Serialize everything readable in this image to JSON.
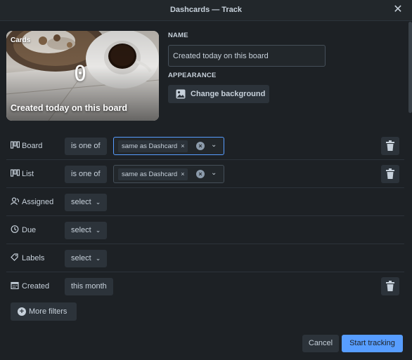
{
  "window": {
    "title": "Dashcards — Track",
    "close_glyph": "✕",
    "close_icon": "close-icon"
  },
  "preview": {
    "cards_label": "Cards",
    "count": "0",
    "name": "Created today on this board"
  },
  "name_section": {
    "label": "NAME",
    "value": "Created today on this board"
  },
  "appearance": {
    "label": "APPEARANCE",
    "button_label": "Change background",
    "icon": "image-icon"
  },
  "filters": [
    {
      "key": "board",
      "label": "Board",
      "icon": "board-icon",
      "operator": "is one of",
      "tag": "same as Dashcard",
      "focused": true,
      "deletable": true
    },
    {
      "key": "list",
      "label": "List",
      "icon": "list-icon",
      "operator": "is one of",
      "tag": "same as Dashcard",
      "focused": false,
      "deletable": true
    },
    {
      "key": "assigned",
      "label": "Assigned",
      "icon": "people-icon",
      "select": "select",
      "deletable": false
    },
    {
      "key": "due",
      "label": "Due",
      "icon": "clock-icon",
      "select": "select",
      "deletable": false
    },
    {
      "key": "labels",
      "label": "Labels",
      "icon": "tag-icon",
      "select": "select",
      "deletable": false
    },
    {
      "key": "created",
      "label": "Created",
      "icon": "calendar-icon",
      "select": "this month",
      "deletable": true
    }
  ],
  "tag_remove_glyph": "×",
  "chevron_glyph": "⌄",
  "clear_glyph": "×",
  "more_filters": {
    "label": "More filters",
    "plus_glyph": "+"
  },
  "footer": {
    "cancel_label": "Cancel",
    "start_label": "Start tracking"
  },
  "colors": {
    "background": "#1d2125",
    "accent": "#579dff",
    "surface": "#2c333a",
    "text": "#c7d1db"
  }
}
